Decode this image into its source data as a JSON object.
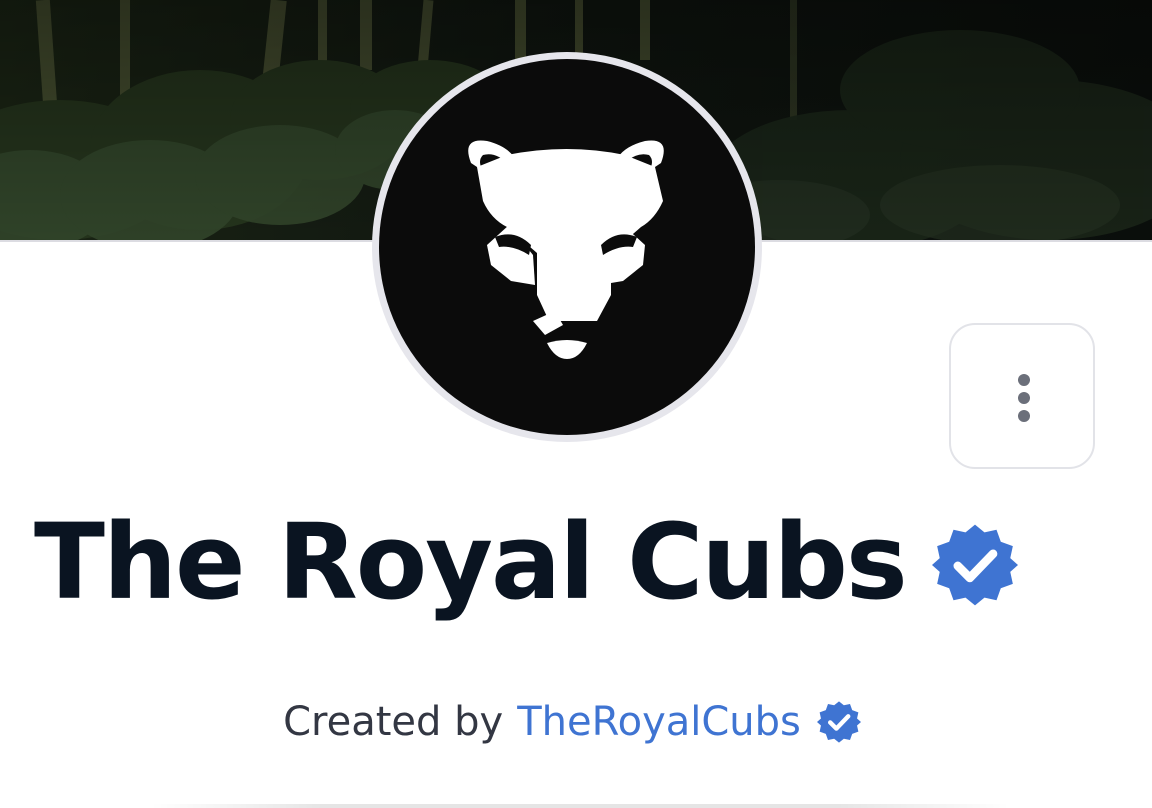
{
  "collection": {
    "title": "The Royal Cubs",
    "verified": true,
    "verified_icon": "verified-badge-icon",
    "avatar_icon": "lion-cub-logo-icon"
  },
  "creator": {
    "prefix": "Created by",
    "name": "TheRoyalCubs",
    "verified": true
  },
  "actions": {
    "more_icon": "vertical-ellipsis-icon"
  },
  "banner": {
    "description_icon": "jungle-banner-image"
  },
  "colors": {
    "title_text": "#0a1421",
    "creator_link": "#3f74d2",
    "verified_badge": "#3f74d2",
    "avatar_background": "#0b0b0b",
    "avatar_logo": "#ffffff",
    "body_text": "#333743"
  }
}
